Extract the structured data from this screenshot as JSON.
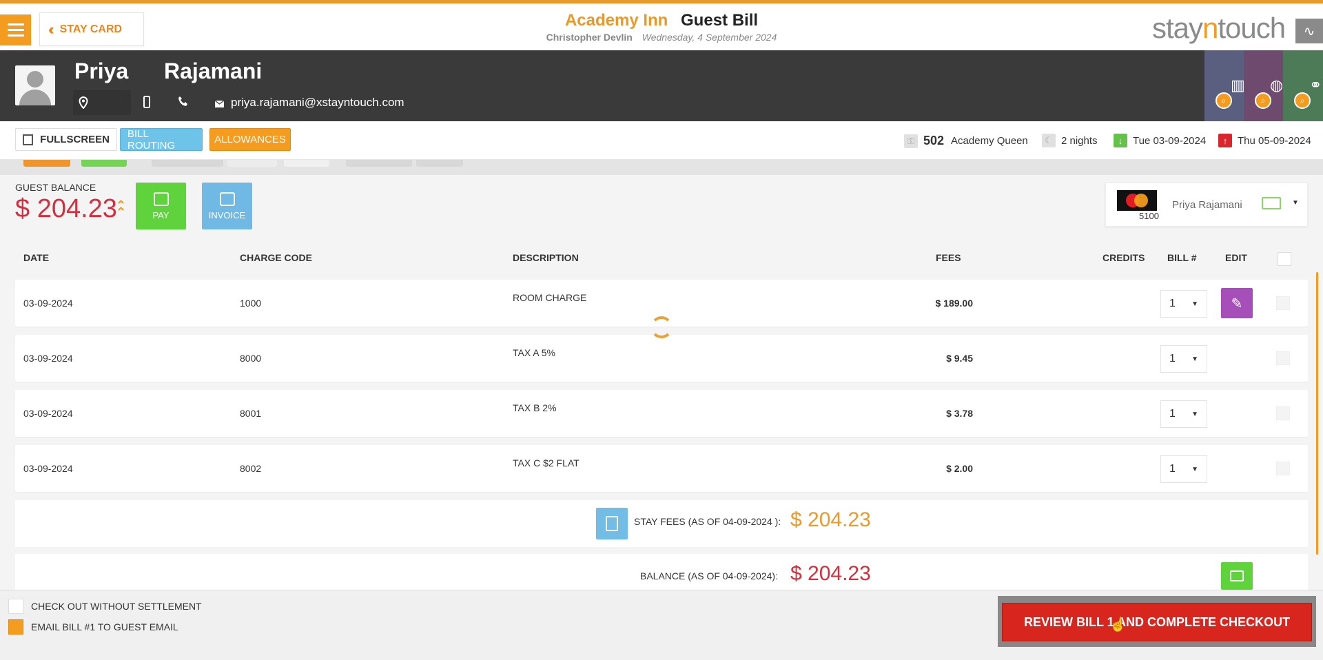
{
  "header": {
    "stay_card_label": "STAY CARD",
    "hotel_name": "Academy Inn",
    "page_title": "Guest Bill",
    "user_name": "Christopher Devlin",
    "business_date": "Wednesday, 4 September 2024",
    "brand": {
      "pre": "stay",
      "accent": "n",
      "post": "touch"
    }
  },
  "guest": {
    "first_name": "Priya",
    "last_name": "Rajamani",
    "email": "priya.rajamani@xstayntouch.com",
    "icons": [
      "location-icon",
      "mobile-icon",
      "phone-icon",
      "email-icon"
    ]
  },
  "actions": {
    "fullscreen": "FULLSCREEN",
    "bill_routing": "BILL ROUTING",
    "allowances": "ALLOWANCES"
  },
  "stay": {
    "room_number": "502",
    "room_type": "Academy Queen",
    "nights": "2 nights",
    "arrival": "Tue 03-09-2024",
    "departure": "Thu 05-09-2024"
  },
  "balance": {
    "label": "GUEST BALANCE",
    "amount": "$ 204.23",
    "pay_label": "PAY",
    "invoice_label": "INVOICE"
  },
  "payment_card": {
    "last_digits": "5100",
    "holder": "Priya Rajamani"
  },
  "table": {
    "headers": {
      "date": "DATE",
      "charge_code": "CHARGE CODE",
      "description": "DESCRIPTION",
      "fees": "FEES",
      "credits": "CREDITS",
      "bill": "BILL #",
      "edit": "EDIT"
    },
    "rows": [
      {
        "date": "03-09-2024",
        "code": "1000",
        "description": "ROOM CHARGE",
        "fees": "$ 189.00",
        "bill": "1"
      },
      {
        "date": "03-09-2024",
        "code": "8000",
        "description": "TAX A 5%",
        "fees": "$ 9.45",
        "bill": "1"
      },
      {
        "date": "03-09-2024",
        "code": "8001",
        "description": "TAX B 2%",
        "fees": "$ 3.78",
        "bill": "1"
      },
      {
        "date": "03-09-2024",
        "code": "8002",
        "description": "TAX C $2 FLAT",
        "fees": "$ 2.00",
        "bill": "1"
      }
    ]
  },
  "summary": {
    "stay_fees_label": "STAY FEES (AS OF  04-09-2024 ):",
    "stay_fees_amount": "$ 204.23",
    "balance_label": "BALANCE (AS OF  04-09-2024):",
    "balance_amount": "$ 204.23"
  },
  "footer": {
    "checkout_without_settlement": "CHECK OUT WITHOUT SETTLEMENT",
    "email_bill": "EMAIL BILL #1 TO GUEST EMAIL",
    "email_bill_checked": true,
    "checkout_button": "REVIEW BILL 1 AND COMPLETE CHECKOUT"
  },
  "colors": {
    "accent": "#f39c1f",
    "balance_red": "#d32f3f",
    "pay_green": "#5fd33c",
    "invoice_blue": "#6fb9e4",
    "edit_purple": "#a64fb8",
    "checkout_red": "#d8261f"
  }
}
